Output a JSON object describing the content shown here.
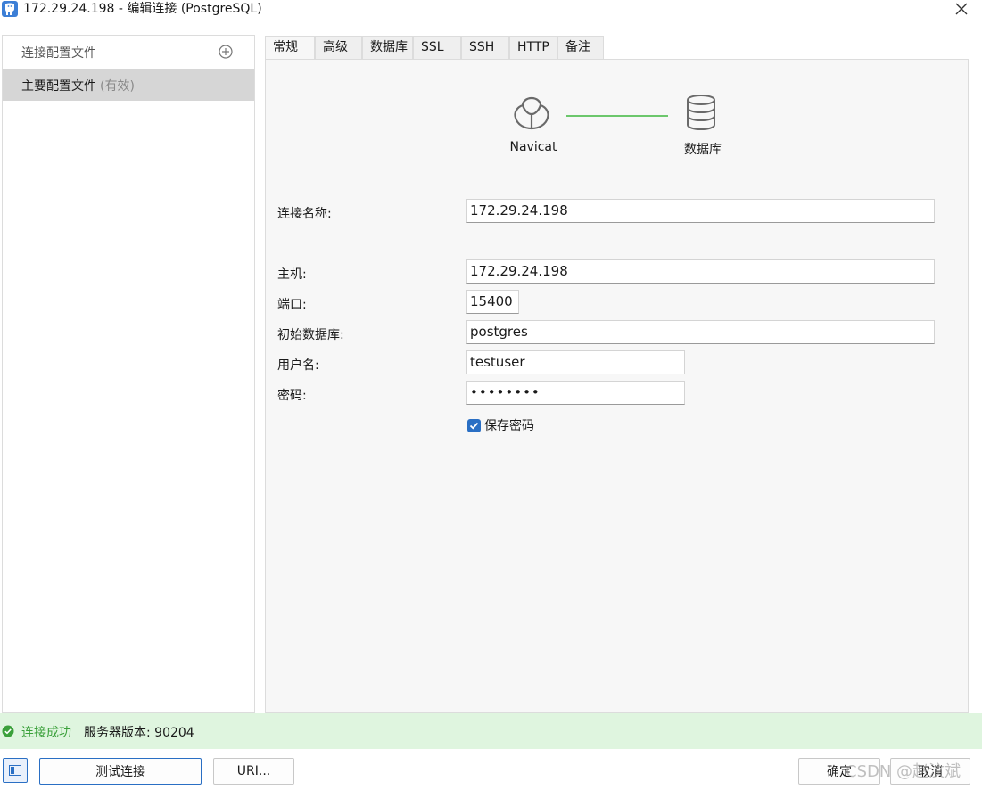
{
  "window": {
    "title": "172.29.24.198 - 编辑连接 (PostgreSQL)",
    "close_icon": "close-icon"
  },
  "sidebar": {
    "header": "连接配置文件",
    "add_icon": "plus-circle-icon",
    "items": [
      {
        "label": "主要配置文件",
        "status": "(有效)"
      }
    ]
  },
  "tabs": [
    {
      "label": "常规",
      "active": true
    },
    {
      "label": "高级"
    },
    {
      "label": "数据库"
    },
    {
      "label": "SSL"
    },
    {
      "label": "SSH"
    },
    {
      "label": "HTTP"
    },
    {
      "label": "备注"
    }
  ],
  "diagram": {
    "left_label": "Navicat",
    "right_label": "数据库",
    "line_color": "#6cc76c"
  },
  "form": {
    "connection_name": {
      "label": "连接名称:",
      "value": "172.29.24.198"
    },
    "host": {
      "label": "主机:",
      "value": "172.29.24.198"
    },
    "port": {
      "label": "端口:",
      "value": "15400"
    },
    "initial_db": {
      "label": "初始数据库:",
      "value": "postgres"
    },
    "username": {
      "label": "用户名:",
      "value": "testuser"
    },
    "password": {
      "label": "密码:",
      "value": "••••••••"
    },
    "save_password": {
      "label": "保存密码",
      "checked": true
    }
  },
  "status": {
    "text": "连接成功",
    "version": "服务器版本: 90204",
    "color": "#3aa03a"
  },
  "buttons": {
    "test": "测试连接",
    "uri": "URI...",
    "ok": "确定",
    "cancel": "取消"
  },
  "watermark": "CSDN @赵汶斌",
  "colors": {
    "accent": "#2a6fc4",
    "status_bg": "#dff5df"
  }
}
